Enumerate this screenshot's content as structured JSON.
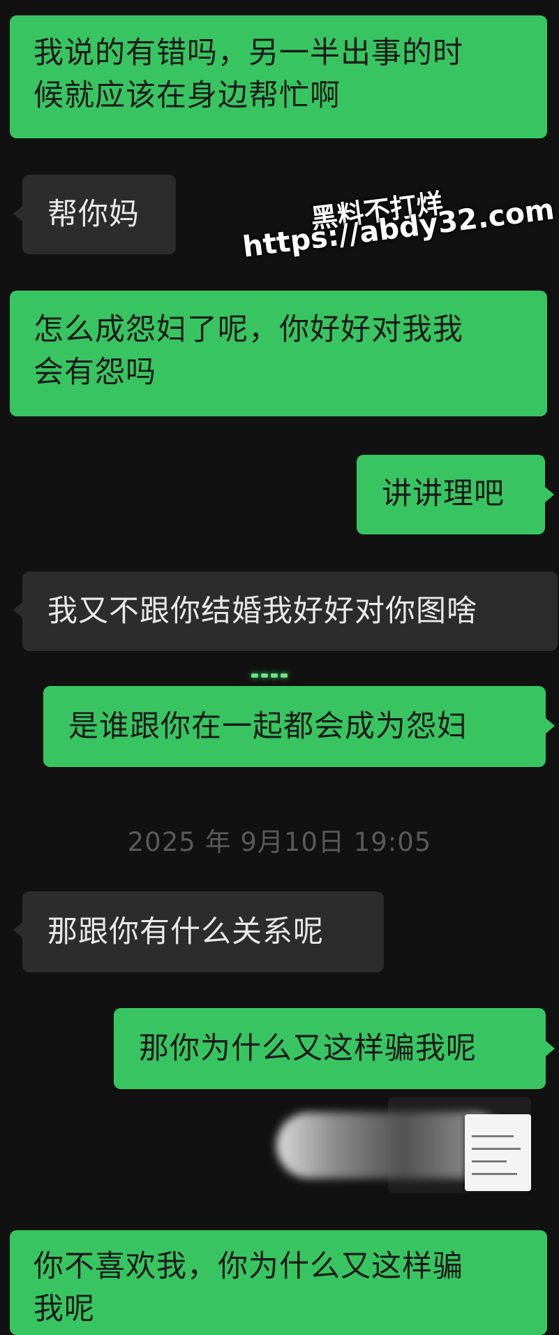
{
  "messages": [
    {
      "side": "out",
      "text_lines": [
        "我说的有错吗，另一半出事的时",
        "候就应该在身边帮忙啊"
      ]
    },
    {
      "side": "in",
      "text_lines": [
        "帮你妈"
      ]
    },
    {
      "side": "out",
      "text_lines": [
        "怎么成怨妇了呢，你好好对我我",
        "会有怨吗"
      ]
    },
    {
      "side": "out",
      "text_lines": [
        "讲讲理吧"
      ]
    },
    {
      "side": "in",
      "text_lines": [
        "我又不跟你结婚我好好对你图啥"
      ]
    },
    {
      "side": "out",
      "text_lines": [
        "是谁跟你在一起都会成为怨妇"
      ]
    },
    {
      "side": "in",
      "text_lines": [
        "那跟你有什么关系呢"
      ]
    },
    {
      "side": "out",
      "text_lines": [
        "那你为什么又这样骗我呢"
      ]
    },
    {
      "side": "out",
      "text_lines": [
        "你不喜欢我，你为什么又这样骗",
        "我呢"
      ]
    }
  ],
  "timestamp": "2025 年 9月10日 19:05",
  "watermark": {
    "line1": "黑料不打烊",
    "line2": "https://abdy32.com"
  },
  "colors": {
    "background": "#111111",
    "outgoing_bubble": "#38c561",
    "incoming_bubble": "#2c2c2c",
    "timestamp_text": "#5a5a5a"
  }
}
